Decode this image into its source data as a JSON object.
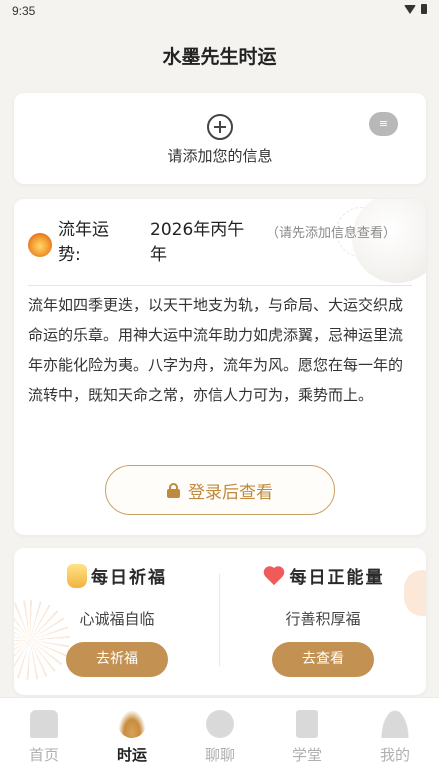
{
  "status_bar": {
    "time": "9:35"
  },
  "header": {
    "title": "水墨先生时运"
  },
  "add_info": {
    "text": "请添加您的信息",
    "badge": "≡"
  },
  "fortune": {
    "label": "流年运势:",
    "year": "2026年丙午年",
    "hint": "（请先添加信息查看）",
    "body": "流年如四季更迭，以天干地支为轨，与命局、大运交织成命运的乐章。用神大运中流年助力如虎添翼，忌神运里流年亦能化险为夷。八字为舟，流年为风。愿您在每一年的流转中，既知天命之常，亦信人力可为，乘势而上。",
    "login_button": "登录后查看"
  },
  "daily": {
    "blessing": {
      "title": "每日祈福",
      "subtitle": "心诚福自临",
      "button": "去祈福",
      "icon": "lamp-icon"
    },
    "energy": {
      "title": "每日正能量",
      "subtitle": "行善积厚福",
      "button": "去查看",
      "icon": "heart-hands-icon"
    }
  },
  "tabbar": {
    "items": [
      {
        "label": "首页",
        "icon": "home-icon",
        "active": false
      },
      {
        "label": "时运",
        "icon": "lotus-icon",
        "active": true
      },
      {
        "label": "聊聊",
        "icon": "chat-icon",
        "active": false
      },
      {
        "label": "学堂",
        "icon": "book-icon",
        "active": false
      },
      {
        "label": "我的",
        "icon": "user-icon",
        "active": false
      }
    ]
  },
  "colors": {
    "accent": "#c39252",
    "accent_text": "#c08a3e",
    "background": "#f5f3f0"
  }
}
